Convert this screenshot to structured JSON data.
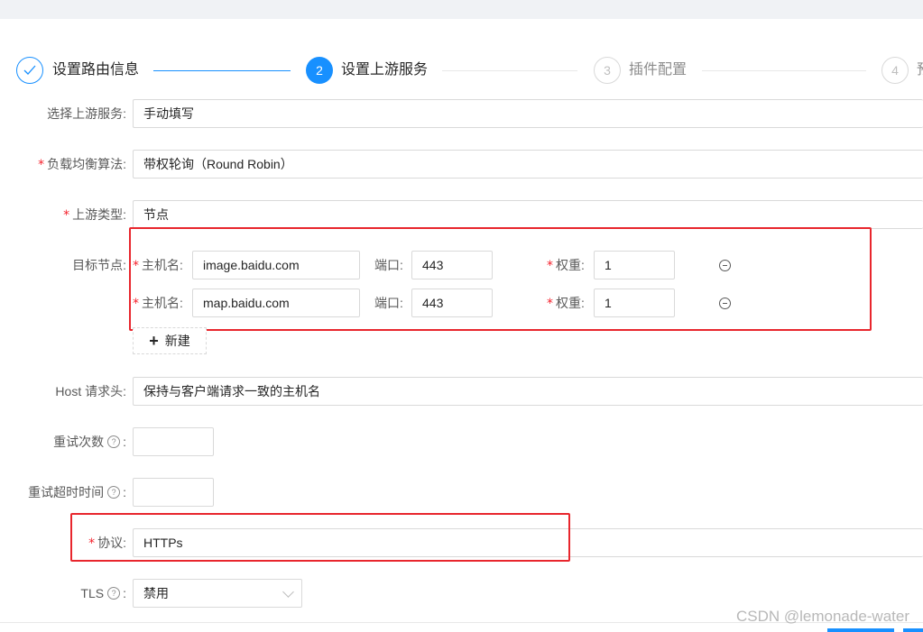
{
  "steps": [
    {
      "number": "",
      "title": "设置路由信息"
    },
    {
      "number": "2",
      "title": "设置上游服务"
    },
    {
      "number": "3",
      "title": "插件配置"
    },
    {
      "number": "4",
      "title": "预"
    }
  ],
  "form": {
    "upstream_service": {
      "label": "选择上游服务",
      "value": "手动填写"
    },
    "lb_algorithm": {
      "label": "负载均衡算法",
      "value": "带权轮询（Round Robin）"
    },
    "upstream_type": {
      "label": "上游类型",
      "value": "节点"
    },
    "target_nodes": {
      "label": "目标节点",
      "host_label": "主机名",
      "port_label": "端口",
      "weight_label": "权重",
      "nodes": [
        {
          "host": "image.baidu.com",
          "port": "443",
          "weight": "1"
        },
        {
          "host": "map.baidu.com",
          "port": "443",
          "weight": "1"
        }
      ],
      "add_label": "新建"
    },
    "host_header": {
      "label": "Host 请求头",
      "value": "保持与客户端请求一致的主机名"
    },
    "retries": {
      "label": "重试次数",
      "value": ""
    },
    "retry_timeout": {
      "label": "重试超时时间",
      "value": ""
    },
    "protocol": {
      "label": "协议",
      "value": "HTTPs"
    },
    "tls": {
      "label": "TLS",
      "value": "禁用"
    }
  },
  "colon": ":",
  "required_mark": "*",
  "help_glyph": "?",
  "check_glyph": "✓",
  "plus_glyph": "+",
  "watermark": "CSDN @lemonade-water",
  "colors": {
    "primary": "#1890ff",
    "required": "#f5222d",
    "highlight": "#e8262d"
  }
}
